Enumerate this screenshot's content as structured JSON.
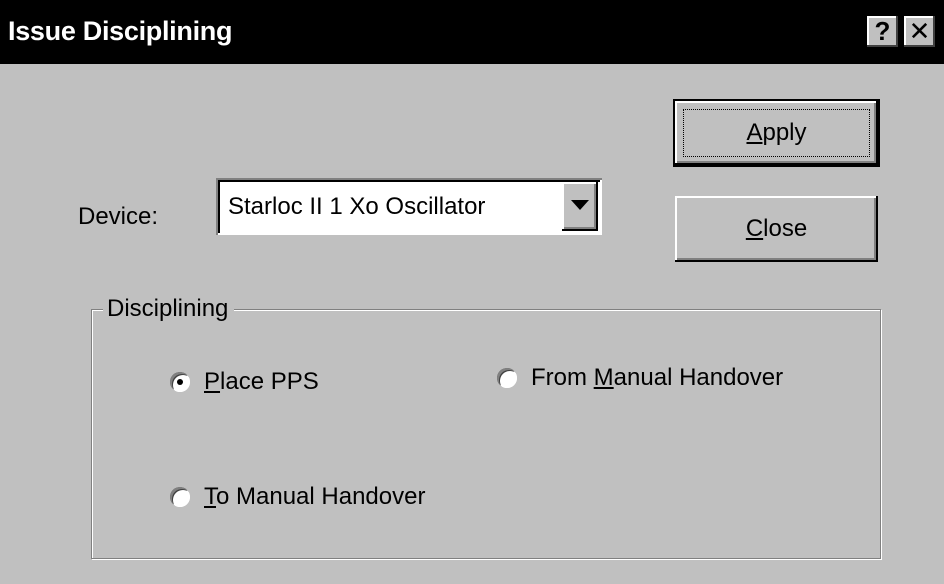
{
  "window": {
    "title": "Issue Disciplining",
    "help_glyph": "?",
    "close_glyph": "✕"
  },
  "buttons": {
    "apply": {
      "mnemonic": "A",
      "rest": "pply"
    },
    "close": {
      "mnemonic": "C",
      "rest": "lose"
    }
  },
  "device": {
    "label": "Device:",
    "selected": "Starloc II 1 Xo Oscillator",
    "dropdown_icon": "chevron-down-icon"
  },
  "disciplining": {
    "group_label": "Disciplining",
    "options": [
      {
        "pre": "",
        "mnemonic": "P",
        "rest": "lace PPS",
        "selected": true
      },
      {
        "pre": "From ",
        "mnemonic": "M",
        "rest": "anual Handover",
        "selected": false
      },
      {
        "pre": "",
        "mnemonic": "T",
        "rest": "o Manual Handover",
        "selected": false
      }
    ]
  }
}
